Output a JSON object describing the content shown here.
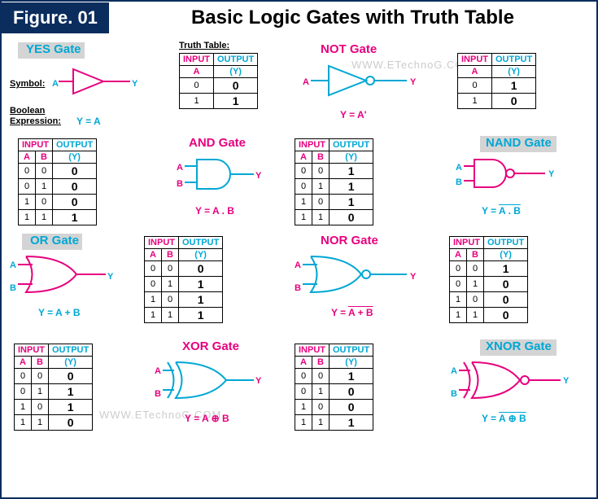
{
  "figure_badge": "Figure. 01",
  "title": "Basic Logic Gates with Truth Table",
  "watermark": "WWW.ETechnoG.COM",
  "labels": {
    "symbol": "Symbol:",
    "boolean_expr": "Boolean Expression:",
    "truth_table": "Truth Table:",
    "input": "INPUT",
    "output": "OUTPUT",
    "A": "A",
    "B": "B",
    "Y": "(Y)",
    "YL": "Y"
  },
  "gates": {
    "yes": {
      "name": "YES Gate",
      "expr": "Y = A",
      "truth": [
        [
          "0",
          "0"
        ],
        [
          "1",
          "1"
        ]
      ]
    },
    "not": {
      "name": "NOT Gate",
      "expr": "Y = A'",
      "truth": [
        [
          "0",
          "1"
        ],
        [
          "1",
          "0"
        ]
      ]
    },
    "and": {
      "name": "AND Gate",
      "expr": "Y = A . B",
      "truth": [
        [
          "0",
          "0",
          "0"
        ],
        [
          "0",
          "1",
          "0"
        ],
        [
          "1",
          "0",
          "0"
        ],
        [
          "1",
          "1",
          "1"
        ]
      ]
    },
    "nand": {
      "name": "NAND Gate",
      "expr_pre": "Y = ",
      "expr_ov": "A . B",
      "truth": [
        [
          "0",
          "0",
          "1"
        ],
        [
          "0",
          "1",
          "1"
        ],
        [
          "1",
          "0",
          "1"
        ],
        [
          "1",
          "1",
          "0"
        ]
      ]
    },
    "or": {
      "name": "OR Gate",
      "expr": "Y = A + B",
      "truth": [
        [
          "0",
          "0",
          "0"
        ],
        [
          "0",
          "1",
          "1"
        ],
        [
          "1",
          "0",
          "1"
        ],
        [
          "1",
          "1",
          "1"
        ]
      ]
    },
    "nor": {
      "name": "NOR Gate",
      "expr_pre": "Y = ",
      "expr_ov": "A + B",
      "truth": [
        [
          "0",
          "0",
          "1"
        ],
        [
          "0",
          "1",
          "0"
        ],
        [
          "1",
          "0",
          "0"
        ],
        [
          "1",
          "1",
          "0"
        ]
      ]
    },
    "xor": {
      "name": "XOR Gate",
      "expr": "Y = A ⊕ B",
      "truth": [
        [
          "0",
          "0",
          "0"
        ],
        [
          "0",
          "1",
          "1"
        ],
        [
          "1",
          "0",
          "1"
        ],
        [
          "1",
          "1",
          "0"
        ]
      ]
    },
    "xnor": {
      "name": "XNOR Gate",
      "expr_pre": "Y = ",
      "expr_ov": "A ⊕ B",
      "truth": [
        [
          "0",
          "0",
          "1"
        ],
        [
          "0",
          "1",
          "0"
        ],
        [
          "1",
          "0",
          "0"
        ],
        [
          "1",
          "1",
          "1"
        ]
      ]
    }
  }
}
